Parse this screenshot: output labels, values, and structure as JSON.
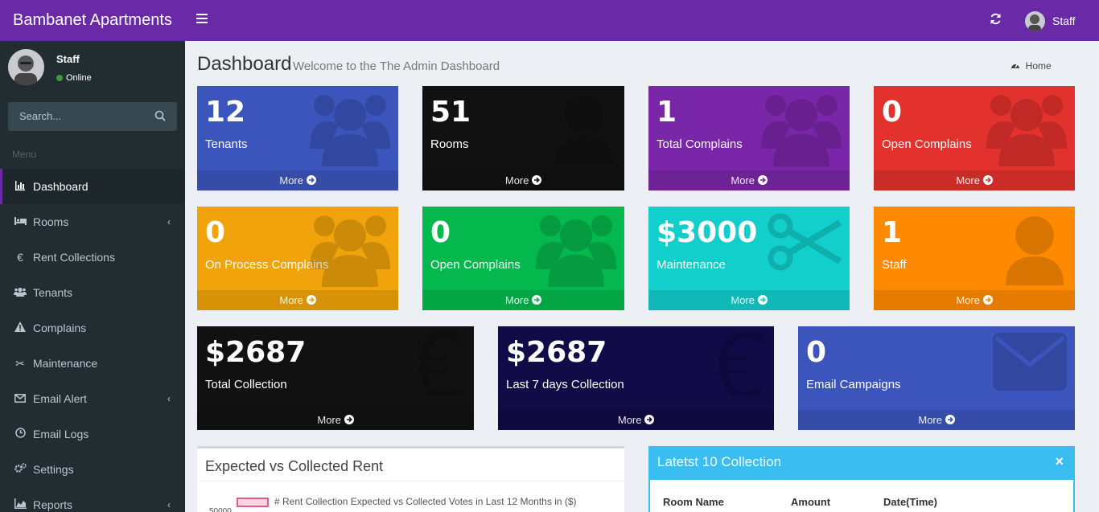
{
  "app": {
    "brand": "Bambanet Apartments"
  },
  "user": {
    "name": "Staff",
    "status": "Online"
  },
  "sidebar": {
    "search_placeholder": "Search...",
    "menu_header": "Menu",
    "items": [
      {
        "label": "Dashboard",
        "icon": "bar-chart-icon",
        "active": true
      },
      {
        "label": "Rooms",
        "icon": "bed-icon",
        "has_children": true
      },
      {
        "label": "Rent Collections",
        "icon": "euro-icon"
      },
      {
        "label": "Tenants",
        "icon": "users-icon"
      },
      {
        "label": "Complains",
        "icon": "warning-icon"
      },
      {
        "label": "Maintenance",
        "icon": "scissors-icon"
      },
      {
        "label": "Email Alert",
        "icon": "envelope-icon",
        "has_children": true
      },
      {
        "label": "Email Logs",
        "icon": "clock-icon"
      },
      {
        "label": "Settings",
        "icon": "gears-icon"
      },
      {
        "label": "Reports",
        "icon": "area-chart-icon",
        "has_children": true
      }
    ]
  },
  "header": {
    "user_name": "Staff"
  },
  "page": {
    "title": "Dashboard",
    "subtitle": "Welcome to the The Admin Dashboard",
    "breadcrumb": "Home"
  },
  "stats": [
    {
      "value": "12",
      "label": "Tenants",
      "more": "More",
      "color": "#3c55bd",
      "icon": "users-icon"
    },
    {
      "value": "51",
      "label": "Rooms",
      "more": "More",
      "color": "#111111",
      "icon": "user-icon"
    },
    {
      "value": "1",
      "label": "Total Complains",
      "more": "More",
      "color": "#7a26a8",
      "icon": "users-icon"
    },
    {
      "value": "0",
      "label": "Open Complains",
      "more": "More",
      "color": "#e3312d",
      "icon": "users-icon"
    },
    {
      "value": "0",
      "label": "On Process Complains",
      "more": "More",
      "color": "#f0a30a",
      "icon": "users-icon"
    },
    {
      "value": "0",
      "label": "Open Complains",
      "more": "More",
      "color": "#05b84d",
      "icon": "users-icon"
    },
    {
      "value": "$3000",
      "label": "Maintenance",
      "more": "More",
      "color": "#12cfcb",
      "icon": "scissors-icon"
    },
    {
      "value": "1",
      "label": "Staff",
      "more": "More",
      "color": "#ff8a00",
      "icon": "user-icon"
    },
    {
      "value": "$2687",
      "label": "Total Collection",
      "more": "More",
      "color": "#111111",
      "icon": "euro-icon"
    },
    {
      "value": "$2687",
      "label": "Last 7 days Collection",
      "more": "More",
      "color": "#110b48",
      "icon": "euro-icon"
    },
    {
      "value": "0",
      "label": "Email Campaigns",
      "more": "More",
      "color": "#3c55bd",
      "icon": "envelope-icon"
    }
  ],
  "chart_panel": {
    "title": "Expected vs Collected Rent",
    "legend": "# Rent Collection Expected vs Collected Votes in Last 12 Months in ($)",
    "y_tick_top": "50000"
  },
  "collection_panel": {
    "title": "Latetst 10 Collection",
    "close": "×",
    "columns": [
      "Room Name",
      "Amount",
      "Date(Time)"
    ]
  }
}
